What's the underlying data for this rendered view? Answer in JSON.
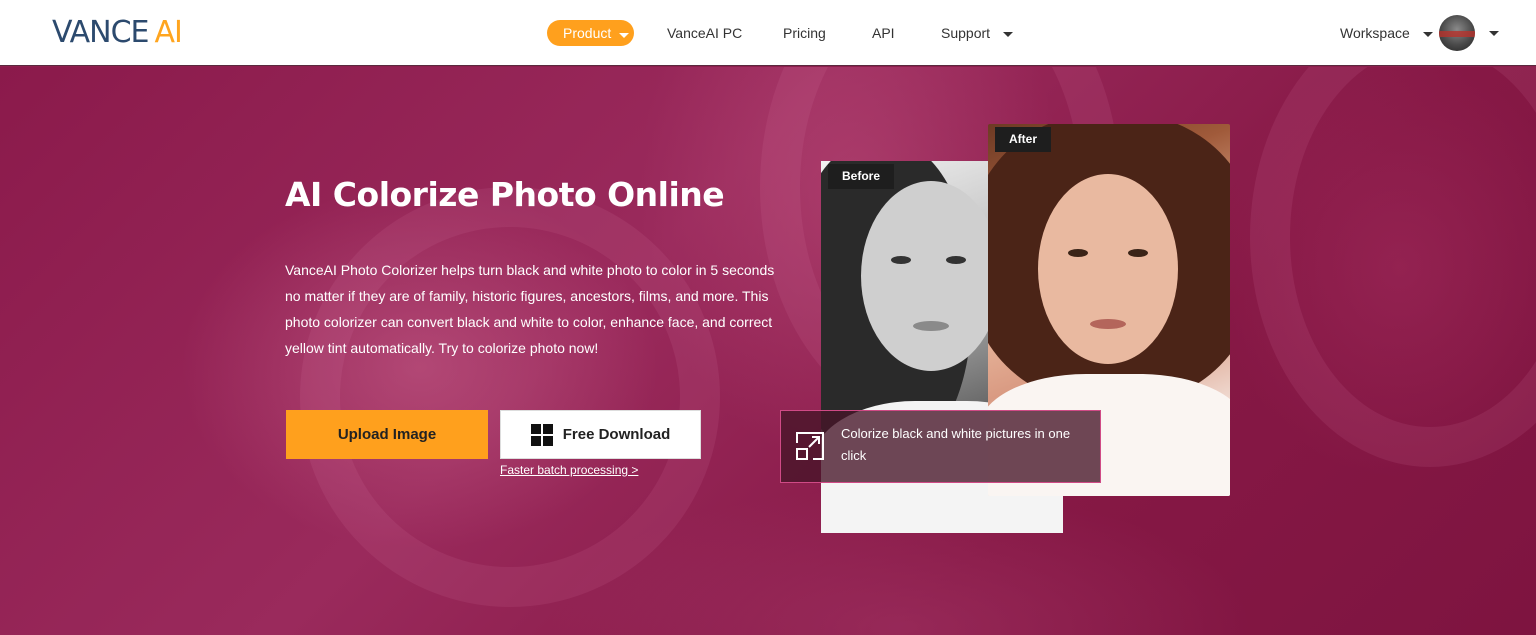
{
  "header": {
    "logo_part1": "VANCE",
    "logo_part2": "AI",
    "nav": {
      "product": "Product",
      "vanceai_pc": "VanceAI PC",
      "pricing": "Pricing",
      "api": "API",
      "support": "Support"
    },
    "workspace": "Workspace"
  },
  "hero": {
    "title": "AI Colorize Photo Online",
    "description": "VanceAI Photo Colorizer helps turn black and white photo to color in 5 seconds no matter if they are of family, historic figures, ancestors, films, and more. This photo colorizer can convert black and white to color, enhance face, and correct yellow tint automatically. Try to colorize photo now!",
    "upload_label": "Upload Image",
    "download_label": "Free Download",
    "batch_link": "Faster batch processing >",
    "before_tag": "Before",
    "after_tag": "After",
    "caption": "Colorize black and white pictures in one click"
  },
  "colors": {
    "accent": "#ffa01d",
    "logo_dark": "#2c4a6e",
    "hero_bg": "#8e1f4e",
    "caption_border": "#d04a86"
  },
  "icons": {
    "windows": "windows-icon",
    "expand": "expand-icon",
    "caret": "chevron-down-icon"
  }
}
